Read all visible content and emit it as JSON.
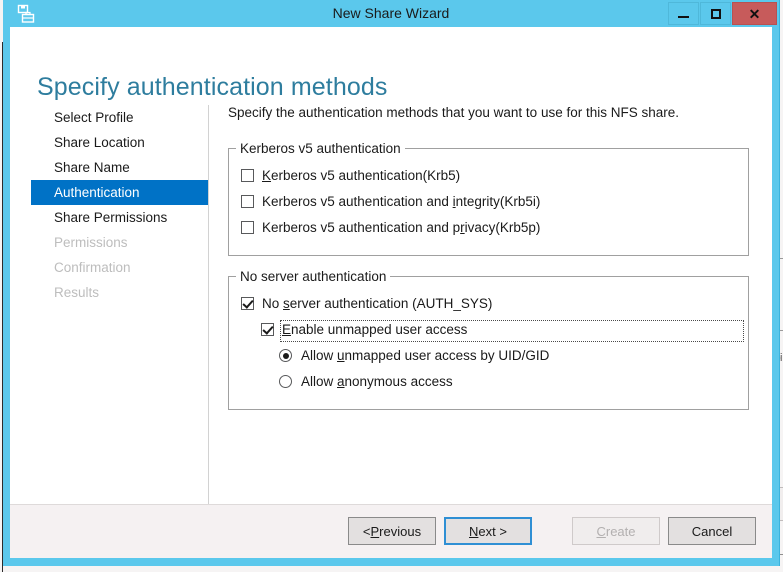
{
  "window": {
    "title": "New Share Wizard",
    "icon": "share-wizard-icon",
    "minimize_label": "Minimize",
    "maximize_label": "Maximize",
    "close_label": "Close",
    "close_glyph": "✕",
    "accent_color": "#5bc8ec",
    "close_color": "#c75b5b"
  },
  "header": {
    "heading": "Specify authentication methods",
    "heading_color": "#2e7d9e"
  },
  "nav": {
    "selected_color": "#0072c6",
    "items": [
      {
        "label": "Select Profile",
        "state": "normal"
      },
      {
        "label": "Share Location",
        "state": "normal"
      },
      {
        "label": "Share Name",
        "state": "normal"
      },
      {
        "label": "Authentication",
        "state": "selected"
      },
      {
        "label": "Share Permissions",
        "state": "normal"
      },
      {
        "label": "Permissions",
        "state": "disabled"
      },
      {
        "label": "Confirmation",
        "state": "disabled"
      },
      {
        "label": "Results",
        "state": "disabled"
      }
    ]
  },
  "main": {
    "intro": "Specify the authentication methods that you want to use for this NFS share.",
    "kerberos_group": {
      "legend": "Kerberos v5 authentication",
      "options": [
        {
          "id": "krb5",
          "pre": "",
          "accel": "K",
          "post": "erberos v5 authentication(Krb5)",
          "checked": false
        },
        {
          "id": "krb5i",
          "pre": "Kerberos v5 authentication and ",
          "accel": "i",
          "post": "ntegrity(Krb5i)",
          "checked": false
        },
        {
          "id": "krb5p",
          "pre": "Kerberos v5 authentication and p",
          "accel": "r",
          "post": "ivacy(Krb5p)",
          "checked": false
        }
      ]
    },
    "no_server_group": {
      "legend": "No server authentication",
      "auth_sys": {
        "pre": "No ",
        "accel": "s",
        "post": "erver authentication (AUTH_SYS)",
        "checked": true
      },
      "unmapped": {
        "pre": "",
        "accel": "E",
        "post": "nable unmapped user access",
        "checked": true,
        "focused": true
      },
      "radios": [
        {
          "id": "by-uid-gid",
          "pre": "Allow ",
          "accel": "u",
          "post": "nmapped user access by UID/GID",
          "selected": true
        },
        {
          "id": "anonymous",
          "pre": "Allow ",
          "accel": "a",
          "post": "nonymous access",
          "selected": false
        }
      ]
    }
  },
  "footer": {
    "buttons": [
      {
        "id": "previous",
        "pre": "< ",
        "accel": "P",
        "post": "revious",
        "state": "normal"
      },
      {
        "id": "next",
        "pre": "",
        "accel": "N",
        "post": "ext >",
        "state": "default"
      },
      {
        "id": "create",
        "pre": "",
        "accel": "C",
        "post": "reate",
        "state": "disabled"
      },
      {
        "id": "cancel",
        "pre": "Cancel",
        "accel": "",
        "post": "",
        "state": "normal"
      }
    ]
  },
  "background": {
    "right_text": "pi"
  }
}
